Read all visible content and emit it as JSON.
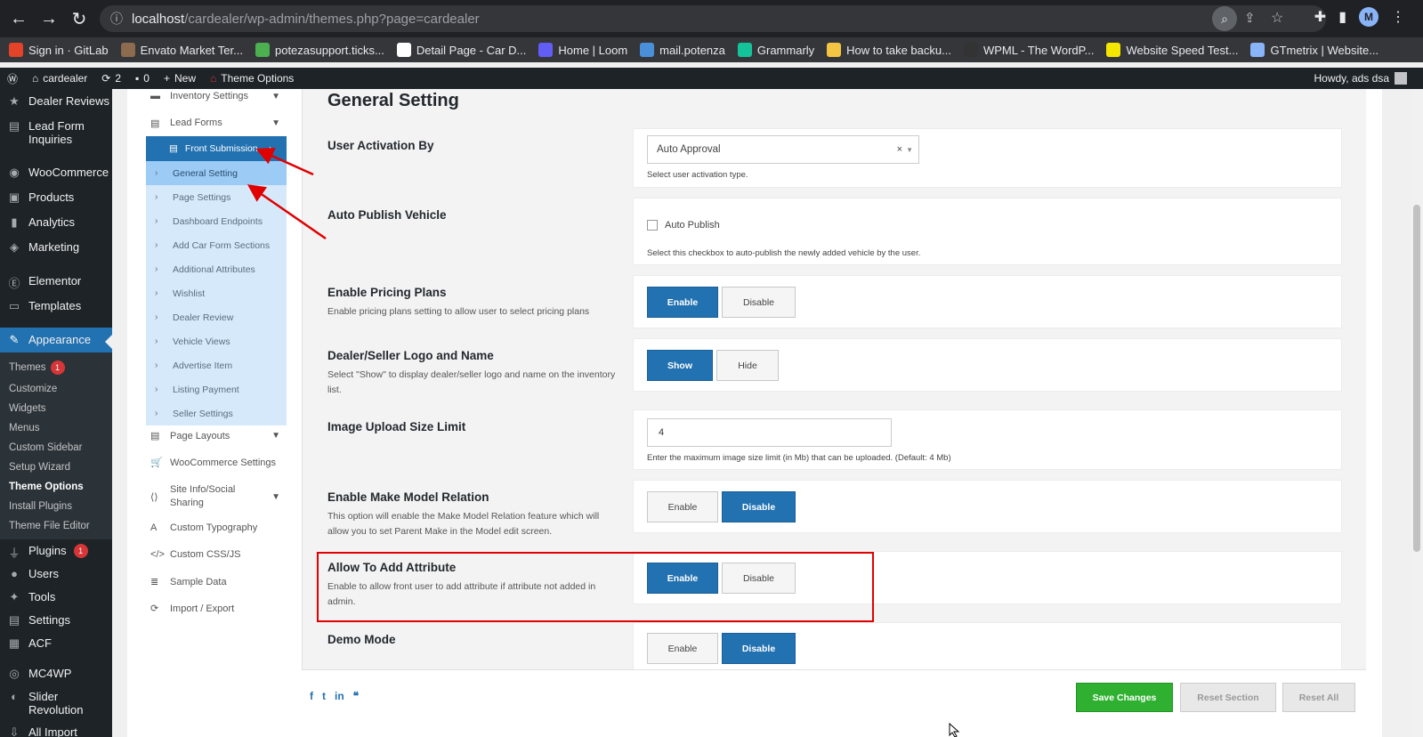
{
  "browser": {
    "url_host": "localhost",
    "url_path": "/cardealer/wp-admin/themes.php?page=cardealer",
    "profile_initial": "M",
    "bookmarks": [
      {
        "label": "Sign in · GitLab",
        "color": "#e24329"
      },
      {
        "label": "Envato Market Ter...",
        "color": "#8c6b4f"
      },
      {
        "label": "potezasupport.ticks...",
        "color": "#4caf50"
      },
      {
        "label": "Detail Page - Car D...",
        "color": "#ffffff"
      },
      {
        "label": "Home | Loom",
        "color": "#625df5"
      },
      {
        "label": "mail.potenza",
        "color": "#4a90d9"
      },
      {
        "label": "Grammarly",
        "color": "#15c39a"
      },
      {
        "label": "How to take backu...",
        "color": "#f4c542"
      },
      {
        "label": "WPML - The WordP...",
        "color": "#333333"
      },
      {
        "label": "Website Speed Test...",
        "color": "#f5e600"
      },
      {
        "label": "GTmetrix | Website...",
        "color": "#8ab4f8"
      }
    ]
  },
  "adminbar": {
    "site_name": "cardealer",
    "updates_count": "2",
    "comments_count": "0",
    "new_label": "New",
    "theme_options_label": "Theme Options",
    "howdy": "Howdy, ads dsa"
  },
  "wpmenu": {
    "top_items": [
      {
        "label": "Dealer Reviews",
        "icon": "star-icon"
      },
      {
        "label": "Lead Form Inquiries",
        "icon": "form-icon"
      },
      {
        "label": "WooCommerce",
        "icon": "woo-icon"
      },
      {
        "label": "Products",
        "icon": "box-icon"
      },
      {
        "label": "Analytics",
        "icon": "bar-chart-icon"
      },
      {
        "label": "Marketing",
        "icon": "megaphone-icon"
      },
      {
        "label": "Elementor",
        "icon": "elementor-icon"
      },
      {
        "label": "Templates",
        "icon": "folder-icon"
      }
    ],
    "active_label": "Appearance",
    "sub_items": [
      {
        "label": "Themes",
        "badge": "1"
      },
      {
        "label": "Customize"
      },
      {
        "label": "Widgets"
      },
      {
        "label": "Menus"
      },
      {
        "label": "Custom Sidebar"
      },
      {
        "label": "Setup Wizard"
      },
      {
        "label": "Theme Options",
        "current": true
      },
      {
        "label": "Install Plugins"
      },
      {
        "label": "Theme File Editor"
      }
    ],
    "bottom_items": [
      {
        "label": "Plugins",
        "badge": "1"
      },
      {
        "label": "Users"
      },
      {
        "label": "Tools"
      },
      {
        "label": "Settings"
      },
      {
        "label": "ACF"
      },
      {
        "label": "MC4WP"
      },
      {
        "label": "Slider Revolution"
      },
      {
        "label": "All Import"
      }
    ]
  },
  "options_sidebar": {
    "inventory_settings": "Inventory Settings",
    "lead_forms": "Lead Forms",
    "front_submission": "Front Submission",
    "front_submission_sub": [
      "General Setting",
      "Page Settings",
      "Dashboard Endpoints",
      "Add Car Form Sections",
      "Additional Attributes",
      "Wishlist",
      "Dealer Review",
      "Vehicle Views",
      "Advertise Item",
      "Listing Payment",
      "Seller Settings"
    ],
    "after_items": [
      "Page Layouts",
      "WooCommerce Settings",
      "Site Info/Social Sharing",
      "Custom Typography",
      "Custom CSS/JS",
      "Sample Data",
      "Import / Export"
    ]
  },
  "main": {
    "title": "General Setting",
    "user_activation": {
      "label": "User Activation By",
      "value": "Auto Approval",
      "hint": "Select user activation type."
    },
    "auto_publish": {
      "label": "Auto Publish Vehicle",
      "checkbox_label": "Auto Publish",
      "hint": "Select this checkbox to auto-publish the newly added vehicle by the user."
    },
    "pricing_plans": {
      "label": "Enable Pricing Plans",
      "desc": "Enable pricing plans setting to allow user to select pricing plans",
      "on": "Enable",
      "off": "Disable"
    },
    "dealer_logo": {
      "label": "Dealer/Seller Logo and Name",
      "desc": "Select \"Show\" to display dealer/seller logo and name on the inventory list.",
      "on": "Show",
      "off": "Hide"
    },
    "image_limit": {
      "label": "Image Upload Size Limit",
      "value": "4",
      "hint": "Enter the maximum image size limit (in Mb) that can be uploaded. (Default: 4 Mb)"
    },
    "make_model": {
      "label": "Enable Make Model Relation",
      "desc": "This option will enable the Make Model Relation feature which will allow you to set Parent Make in the Model edit screen.",
      "on": "Enable",
      "off": "Disable"
    },
    "add_attribute": {
      "label": "Allow To Add Attribute",
      "desc": "Enable to allow front user to add attribute if attribute not added in admin.",
      "on": "Enable",
      "off": "Disable"
    },
    "demo_mode": {
      "label": "Demo Mode",
      "on": "Enable",
      "off": "Disable"
    }
  },
  "footer": {
    "save": "Save Changes",
    "reset_section": "Reset Section",
    "reset_all": "Reset All"
  }
}
